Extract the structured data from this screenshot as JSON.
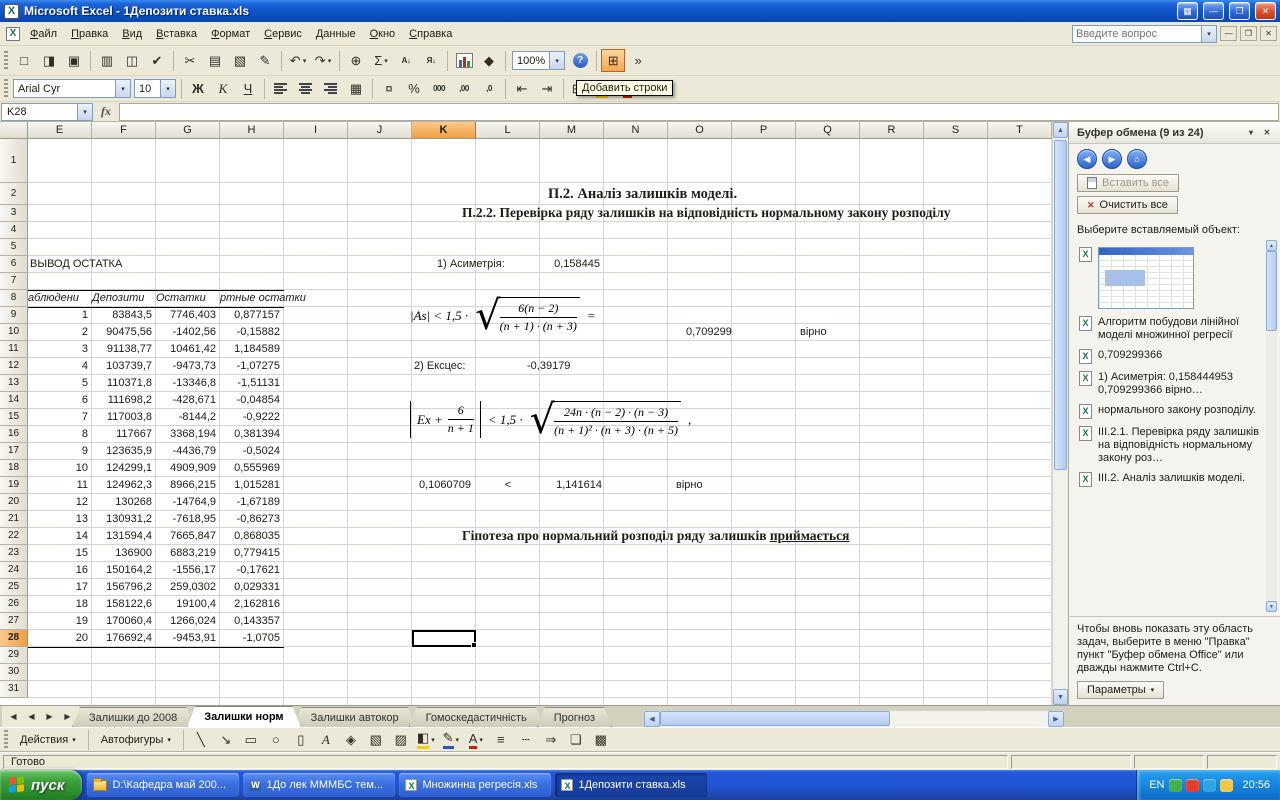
{
  "icons": {
    "caret_down": "▾",
    "up": "▲",
    "down": "▼",
    "left": "◀",
    "right": "▶",
    "close": "✕",
    "excel": "X"
  },
  "window": {
    "title": "Microsoft Excel - 1Депозити ставка.xls",
    "buttons": {
      "grid": "▦",
      "minimize": "—",
      "maximize": "❐",
      "close": "✕"
    }
  },
  "menu": {
    "items": [
      "Файл",
      "Правка",
      "Вид",
      "Вставка",
      "Формат",
      "Сервис",
      "Данные",
      "Окно",
      "Справка"
    ],
    "question_placeholder": "Введите вопрос"
  },
  "toolbars": {
    "tooltip": "Добавить строки",
    "zoom_value": "100%",
    "font_name": "Arial Cyr",
    "font_size": "10",
    "standard": [
      {
        "name": "new-button",
        "glyph": "□"
      },
      {
        "name": "open-button",
        "glyph": "◨"
      },
      {
        "name": "save-button",
        "glyph": "▣"
      },
      {
        "sep": true
      },
      {
        "name": "print-button",
        "glyph": "▥"
      },
      {
        "name": "print-preview-button",
        "glyph": "◫"
      },
      {
        "name": "spelling-button",
        "glyph": "✔"
      },
      {
        "sep": true
      },
      {
        "name": "cut-button",
        "glyph": "✂"
      },
      {
        "name": "copy-button",
        "glyph": "▤"
      },
      {
        "name": "paste-button",
        "glyph": "▧"
      },
      {
        "name": "format-painter-button",
        "glyph": "✎"
      },
      {
        "sep": true
      },
      {
        "name": "undo-button",
        "glyph": "↶",
        "caret": true
      },
      {
        "name": "redo-button",
        "glyph": "↷",
        "caret": true
      },
      {
        "sep": true
      },
      {
        "name": "insert-hyperlink-button",
        "glyph": "⊕"
      },
      {
        "name": "autosum-button",
        "glyph": "Σ",
        "caret": true
      },
      {
        "name": "sort-ascending-button",
        "glyph": "А↓",
        "small": true
      },
      {
        "name": "sort-descending-button",
        "glyph": "Я↓",
        "small": true
      },
      {
        "sep": true
      },
      {
        "name": "chart-wizard-button",
        "chart": true
      },
      {
        "name": "drawing-button",
        "glyph": "◆"
      },
      {
        "sep": true
      },
      {
        "zoom": true,
        "name": "zoom-combo"
      },
      {
        "name": "help-button",
        "help": true,
        "glyph": "?"
      },
      {
        "sep": true
      },
      {
        "name": "insert-rows-button",
        "glyph": "⊞",
        "hover": true
      },
      {
        "name": "toolbar-options-button",
        "glyph": "»"
      }
    ],
    "formatting": [
      {
        "font_combo": true,
        "name": "font-name-combo"
      },
      {
        "size_combo": true,
        "name": "font-size-combo"
      },
      {
        "sep": true
      },
      {
        "name": "bold-button",
        "glyph": "Ж",
        "cls": "gb"
      },
      {
        "name": "italic-button",
        "glyph": "К",
        "cls": "gi"
      },
      {
        "name": "underline-button",
        "glyph": "Ч",
        "cls": "gu"
      },
      {
        "sep": true
      },
      {
        "name": "align-left-button",
        "ic": "ic-all"
      },
      {
        "name": "align-center-button",
        "ic": "ic-alc"
      },
      {
        "name": "align-right-button",
        "ic": "ic-alr"
      },
      {
        "name": "merge-center-button",
        "glyph": "▦"
      },
      {
        "sep": true
      },
      {
        "name": "currency-button",
        "glyph": "¤"
      },
      {
        "name": "percent-button",
        "glyph": "%"
      },
      {
        "name": "comma-style-button",
        "glyph": "000",
        "small": true
      },
      {
        "name": "increase-decimal-button",
        "glyph": ",00",
        "small": true
      },
      {
        "name": "decrease-decimal-button",
        "glyph": ",0",
        "small": true
      },
      {
        "sep": true
      },
      {
        "name": "decrease-indent-button",
        "glyph": "⇤"
      },
      {
        "name": "increase-indent-button",
        "glyph": "⇥"
      },
      {
        "sep": true
      },
      {
        "name": "borders-button",
        "glyph": "⊞",
        "caret": true
      },
      {
        "name": "fill-color-button",
        "glyph": "◧",
        "bar": "#F2D000",
        "caret": true
      },
      {
        "name": "font-color-button",
        "glyph": "А",
        "bar": "#D02000",
        "caret": true
      },
      {
        "name": "toolbar-options-button",
        "glyph": "»"
      }
    ]
  },
  "grid": {
    "name_box": "K28",
    "fx": "fx",
    "columns": [
      "E",
      "F",
      "G",
      "H",
      "I",
      "J",
      "K",
      "L",
      "M",
      "N",
      "O",
      "P",
      "Q",
      "R",
      "S",
      "T"
    ],
    "selected_column": "K",
    "selected_row": 28
  },
  "sheet": {
    "title1": "П.2. Аналіз залишків моделі.",
    "title2": "П.2.2. Перевірка ряду залишків на відповідність нормальному закону розподілу",
    "output_label": "ВЫВОД ОСТАТКА",
    "asym_label": "1) Асиметрія:",
    "asym_value": "0,158445",
    "f1_result": "0,709299",
    "f1_verdict": "вірно",
    "excess_label": "2) Ексцес:",
    "excess_value": "-0,39179",
    "check_left": "0,1060709",
    "check_rel": "<",
    "check_right": "1,141614",
    "check_verdict": "вірно",
    "conclusion_pre": "Гіпотеза про нормальний розподіл ряду залишків ",
    "conclusion_underlined": "приймається",
    "table_headers": [
      "аблюдени",
      "Депозити",
      "Остатки",
      "ртные остатки"
    ],
    "table_rows": [
      [
        "1",
        "83843,5",
        "7746,403",
        "0,877157"
      ],
      [
        "2",
        "90475,56",
        "-1402,56",
        "-0,15882"
      ],
      [
        "3",
        "91138,77",
        "10461,42",
        "1,184589"
      ],
      [
        "4",
        "103739,7",
        "-9473,73",
        "-1,07275"
      ],
      [
        "5",
        "110371,8",
        "-13346,8",
        "-1,51131"
      ],
      [
        "6",
        "111698,2",
        "-428,671",
        "-0,04854"
      ],
      [
        "7",
        "117003,8",
        "-8144,2",
        "-0,9222"
      ],
      [
        "8",
        "117667",
        "3368,194",
        "0,381394"
      ],
      [
        "9",
        "123635,9",
        "-4436,79",
        "-0,5024"
      ],
      [
        "10",
        "124299,1",
        "4909,909",
        "0,555969"
      ],
      [
        "11",
        "124962,3",
        "8966,215",
        "1,015281"
      ],
      [
        "12",
        "130268",
        "-14764,9",
        "-1,67189"
      ],
      [
        "13",
        "130931,2",
        "-7618,95",
        "-0,86273"
      ],
      [
        "14",
        "131594,4",
        "7665,847",
        "0,868035"
      ],
      [
        "15",
        "136900",
        "6883,219",
        "0,779415"
      ],
      [
        "16",
        "150164,2",
        "-1556,17",
        "-0,17621"
      ],
      [
        "17",
        "156796,2",
        "259,0302",
        "0,029331"
      ],
      [
        "18",
        "158122,6",
        "19100,4",
        "2,162816"
      ],
      [
        "19",
        "170060,4",
        "1266,024",
        "0,143357"
      ],
      [
        "20",
        "176692,4",
        "-9453,91",
        "-1,0705"
      ]
    ],
    "formula1": {
      "pre": "|As| < 1,5 ·",
      "num": "6(n − 2)",
      "den": "(n + 1) · (n + 3)",
      "post": "="
    },
    "formula2": {
      "pre": "Ex +",
      "num1": "6",
      "den1": "n + 1",
      "mid": "< 1,5 ·",
      "num2": "24n · (n − 2) · (n − 3)",
      "den2": "(n + 1)² · (n + 3) · (n + 5)",
      "post": ","
    }
  },
  "tabs": {
    "nav": [
      "◀",
      "◀",
      "▶",
      "▶"
    ],
    "items": [
      {
        "label": "Залишки до 2008"
      },
      {
        "label": "Залишки норм",
        "active": true
      },
      {
        "label": "Залишки автокор"
      },
      {
        "label": "Гомоскедастичність"
      },
      {
        "label": "Прогноз"
      }
    ]
  },
  "drawing": {
    "actions_label": "Действия",
    "autoshapes_label": "Автофигуры",
    "buttons": [
      {
        "name": "line-icon",
        "glyph": "╲"
      },
      {
        "name": "arrow-icon",
        "glyph": "↘"
      },
      {
        "name": "rectangle-icon",
        "glyph": "▭"
      },
      {
        "name": "oval-icon",
        "glyph": "○"
      },
      {
        "name": "textbox-icon",
        "glyph": "▯"
      },
      {
        "name": "wordart-icon",
        "glyph": "А",
        "cls": "gi"
      },
      {
        "name": "diagram-icon",
        "glyph": "◈"
      },
      {
        "name": "clipart-icon",
        "glyph": "▧"
      },
      {
        "name": "picture-icon",
        "glyph": "▨"
      },
      {
        "name": "fill-color-icon",
        "glyph": "◧",
        "bar": "#F2D000",
        "caret": true
      },
      {
        "name": "line-color-icon",
        "glyph": "✎",
        "bar": "#3050C8",
        "caret": true
      },
      {
        "name": "font-color-icon",
        "glyph": "А",
        "bar": "#D02000",
        "caret": true
      },
      {
        "name": "line-style-icon",
        "glyph": "≡"
      },
      {
        "name": "dash-style-icon",
        "glyph": "┄"
      },
      {
        "name": "arrow-style-icon",
        "glyph": "⇒"
      },
      {
        "name": "shadow-icon",
        "glyph": "❏"
      },
      {
        "name": "threed-icon",
        "glyph": "▩"
      }
    ]
  },
  "status": {
    "ready": "Готово"
  },
  "task_pane": {
    "title": "Буфер обмена (9 из 24)",
    "nav": [
      "◀",
      "▶",
      "⌂"
    ],
    "paste_all_label": "Вставить все",
    "clear_all_label": "Очистить все",
    "prompt": "Выберите вставляемый объект:",
    "items": [
      {
        "type": "thumbnail"
      },
      {
        "type": "text",
        "text": "Алгоритм побудови лінійної моделі множинної регресії"
      },
      {
        "type": "text",
        "text": "0,709299366"
      },
      {
        "type": "text",
        "text": "1) Асиметрія: 0,158444953 0,709299366 вірно…"
      },
      {
        "type": "text",
        "text": "нормального закону розподілу."
      },
      {
        "type": "text",
        "text": "ІІІ.2.1. Перевірка ряду залишків на відповідність нормальному закону роз…"
      },
      {
        "type": "text",
        "text": "ІІІ.2. Аналіз залишків моделі."
      }
    ],
    "footer": "Чтобы вновь показать эту область задач, выберите в меню \"Правка\" пункт \"Буфер обмена Office\" или дважды нажмите Ctrl+C.",
    "options_label": "Параметры"
  },
  "taskbar": {
    "start_label": "пуск",
    "tasks": [
      {
        "icon": "folder",
        "label": "D:\\Кафедра май 200..."
      },
      {
        "icon": "word",
        "glyph": "W",
        "label": "1До лек МММБС тем..."
      },
      {
        "icon": "excel",
        "glyph": "X",
        "label": "Множинна регресія.xls"
      },
      {
        "icon": "excel",
        "glyph": "X",
        "label": "1Депозити ставка.xls",
        "active": true
      }
    ],
    "tray": {
      "lang": "EN",
      "time": "20:56",
      "icons": [
        "#43B04A",
        "#E23E2B",
        "#2FA3E8",
        "#F2C84B"
      ]
    }
  }
}
